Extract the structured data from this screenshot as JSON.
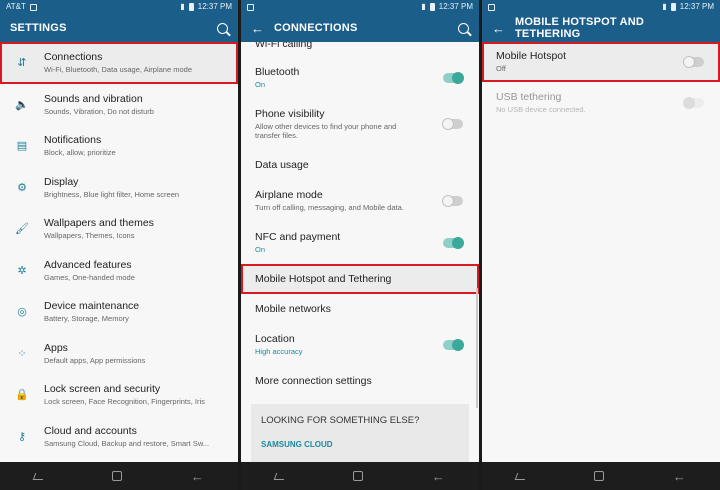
{
  "status_bar": {
    "carrier": "AT&T",
    "time": "12:37 PM",
    "battery": "100%"
  },
  "settings_panel": {
    "title": "SETTINGS",
    "items": [
      {
        "title": "Connections",
        "subtitle": "Wi-Fi, Bluetooth, Data usage, Airplane mode",
        "icon": "connections-icon"
      },
      {
        "title": "Sounds and vibration",
        "subtitle": "Sounds, Vibration, Do not disturb",
        "icon": "speaker-icon"
      },
      {
        "title": "Notifications",
        "subtitle": "Block, allow, prioritize",
        "icon": "notifications-icon"
      },
      {
        "title": "Display",
        "subtitle": "Brightness, Blue light filter, Home screen",
        "icon": "display-icon"
      },
      {
        "title": "Wallpapers and themes",
        "subtitle": "Wallpapers, Themes, Icons",
        "icon": "brush-icon"
      },
      {
        "title": "Advanced features",
        "subtitle": "Games, One-handed mode",
        "icon": "gear-plus-icon"
      },
      {
        "title": "Device maintenance",
        "subtitle": "Battery, Storage, Memory",
        "icon": "maintenance-icon"
      },
      {
        "title": "Apps",
        "subtitle": "Default apps, App permissions",
        "icon": "apps-grid-icon"
      },
      {
        "title": "Lock screen and security",
        "subtitle": "Lock screen, Face Recognition, Fingerprints, Iris",
        "icon": "lock-icon"
      },
      {
        "title": "Cloud and accounts",
        "subtitle": "Samsung Cloud, Backup and restore, Smart Sw...",
        "icon": "key-icon"
      }
    ]
  },
  "connections_panel": {
    "title": "CONNECTIONS",
    "items": [
      {
        "title": "Wi-Fi calling",
        "subtitle": "",
        "toggle": ""
      },
      {
        "title": "Bluetooth",
        "subtitle": "On",
        "toggle": "on"
      },
      {
        "title": "Phone visibility",
        "subtitle": "Allow other devices to find your phone and transfer files.",
        "toggle": "off"
      },
      {
        "title": "Data usage",
        "subtitle": "",
        "toggle": ""
      },
      {
        "title": "Airplane mode",
        "subtitle": "Turn off calling, messaging, and Mobile data.",
        "toggle": "off"
      },
      {
        "title": "NFC and payment",
        "subtitle": "On",
        "toggle": "on"
      },
      {
        "title": "Mobile Hotspot and Tethering",
        "subtitle": "",
        "toggle": ""
      },
      {
        "title": "Mobile networks",
        "subtitle": "",
        "toggle": ""
      },
      {
        "title": "Location",
        "subtitle": "High accuracy",
        "toggle": "on"
      },
      {
        "title": "More connection settings",
        "subtitle": "",
        "toggle": ""
      }
    ],
    "looking_title": "LOOKING FOR SOMETHING ELSE?",
    "looking_link": "SAMSUNG CLOUD"
  },
  "hotspot_panel": {
    "title": "MOBILE HOTSPOT AND TETHERING",
    "items": [
      {
        "title": "Mobile Hotspot",
        "subtitle": "Off",
        "toggle": "off"
      },
      {
        "title": "USB tethering",
        "subtitle": "No USB device connected.",
        "toggle": "disabled"
      }
    ]
  }
}
